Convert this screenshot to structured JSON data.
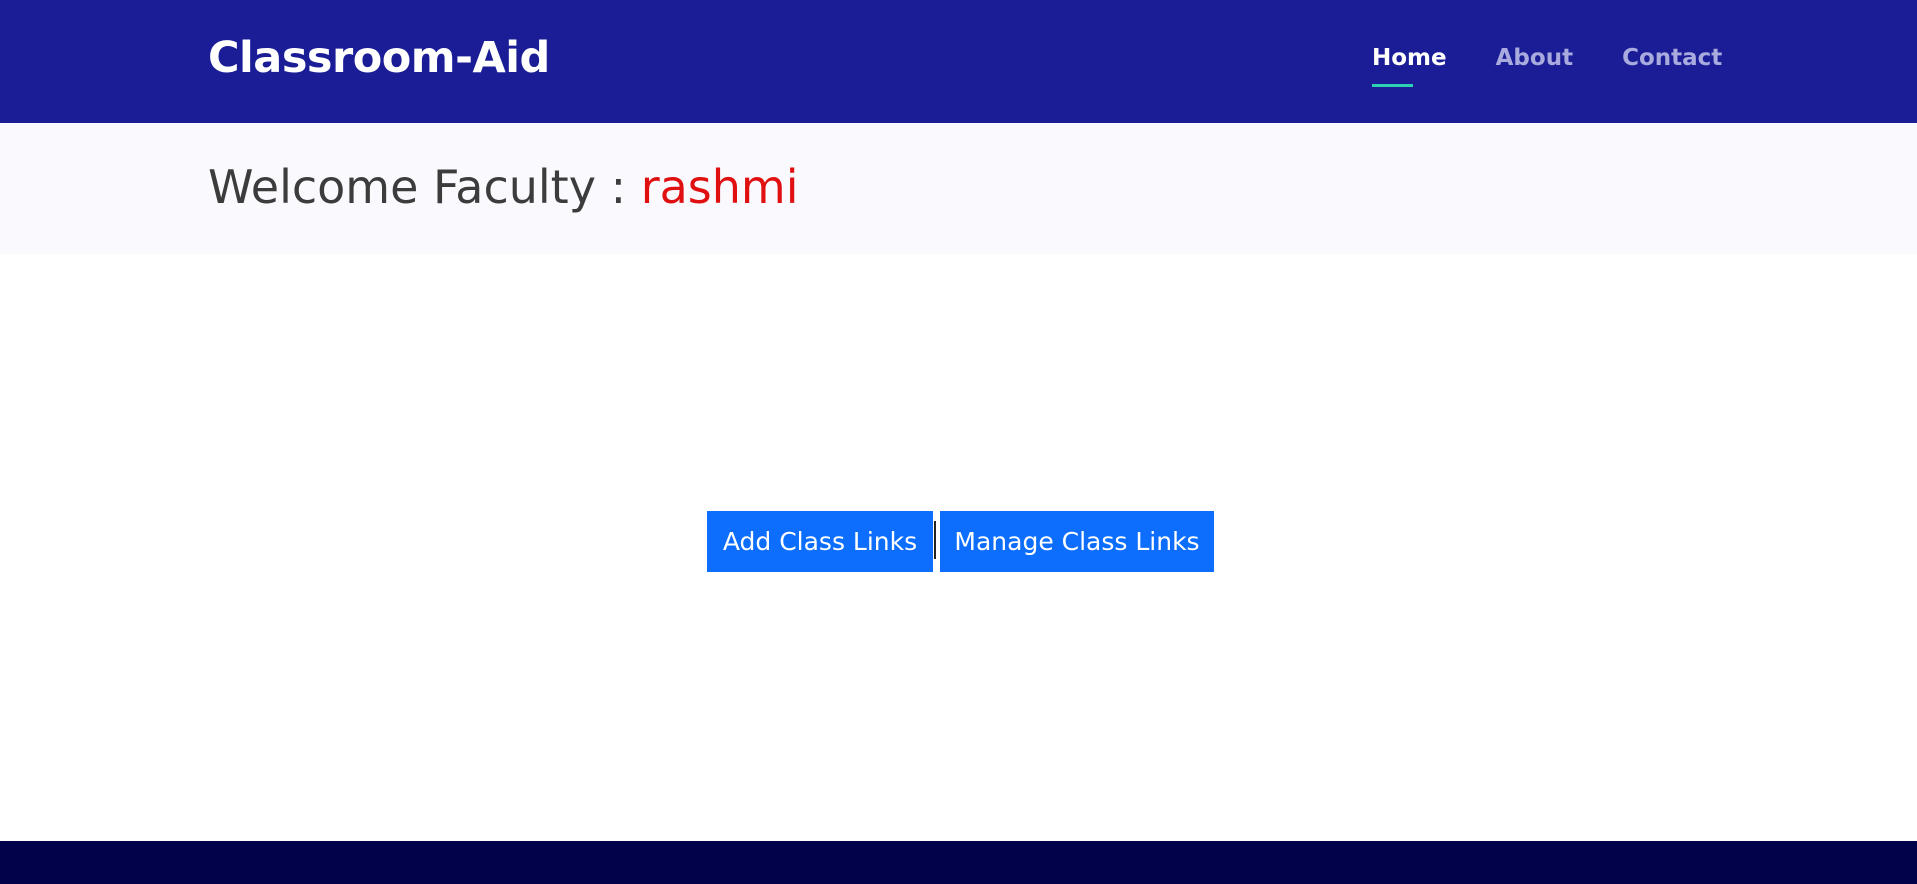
{
  "header": {
    "brand": "Classroom-Aid",
    "nav": [
      {
        "label": "Home",
        "active": true
      },
      {
        "label": "About",
        "active": false
      },
      {
        "label": "Contact",
        "active": false
      }
    ]
  },
  "welcome": {
    "prefix": "Welcome Faculty : ",
    "username": "rashmi"
  },
  "actions": {
    "add_label": "Add Class Links",
    "manage_label": "Manage Class Links"
  },
  "colors": {
    "header_bg": "#1b1d96",
    "nav_active_underline": "#2bd1b0",
    "username": "#e01010",
    "button_bg": "#0d6efd",
    "footer_bg": "#02024a"
  }
}
